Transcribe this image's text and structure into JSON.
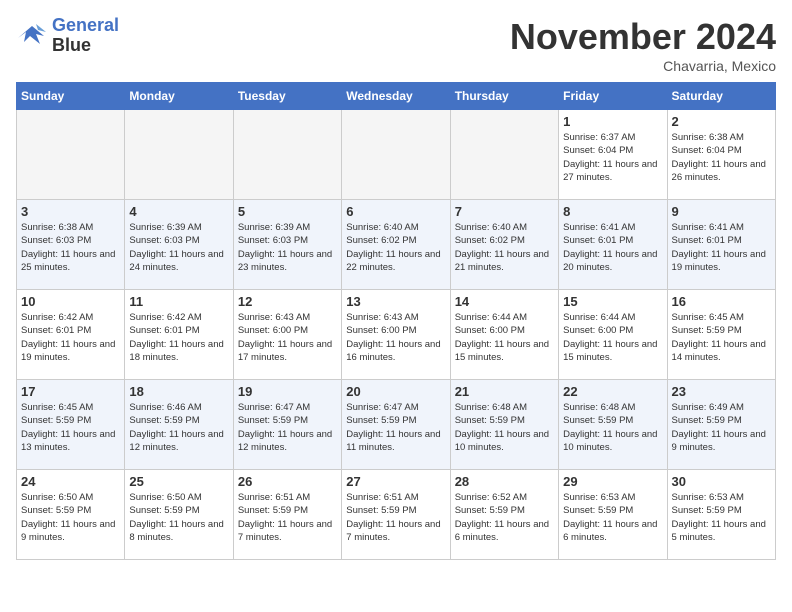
{
  "logo": {
    "line1": "General",
    "line2": "Blue"
  },
  "title": "November 2024",
  "location": "Chavarria, Mexico",
  "days_of_week": [
    "Sunday",
    "Monday",
    "Tuesday",
    "Wednesday",
    "Thursday",
    "Friday",
    "Saturday"
  ],
  "weeks": [
    [
      {
        "day": "",
        "info": "",
        "empty": true
      },
      {
        "day": "",
        "info": "",
        "empty": true
      },
      {
        "day": "",
        "info": "",
        "empty": true
      },
      {
        "day": "",
        "info": "",
        "empty": true
      },
      {
        "day": "",
        "info": "",
        "empty": true
      },
      {
        "day": "1",
        "info": "Sunrise: 6:37 AM\nSunset: 6:04 PM\nDaylight: 11 hours and 27 minutes.",
        "empty": false
      },
      {
        "day": "2",
        "info": "Sunrise: 6:38 AM\nSunset: 6:04 PM\nDaylight: 11 hours and 26 minutes.",
        "empty": false
      }
    ],
    [
      {
        "day": "3",
        "info": "Sunrise: 6:38 AM\nSunset: 6:03 PM\nDaylight: 11 hours and 25 minutes.",
        "empty": false
      },
      {
        "day": "4",
        "info": "Sunrise: 6:39 AM\nSunset: 6:03 PM\nDaylight: 11 hours and 24 minutes.",
        "empty": false
      },
      {
        "day": "5",
        "info": "Sunrise: 6:39 AM\nSunset: 6:03 PM\nDaylight: 11 hours and 23 minutes.",
        "empty": false
      },
      {
        "day": "6",
        "info": "Sunrise: 6:40 AM\nSunset: 6:02 PM\nDaylight: 11 hours and 22 minutes.",
        "empty": false
      },
      {
        "day": "7",
        "info": "Sunrise: 6:40 AM\nSunset: 6:02 PM\nDaylight: 11 hours and 21 minutes.",
        "empty": false
      },
      {
        "day": "8",
        "info": "Sunrise: 6:41 AM\nSunset: 6:01 PM\nDaylight: 11 hours and 20 minutes.",
        "empty": false
      },
      {
        "day": "9",
        "info": "Sunrise: 6:41 AM\nSunset: 6:01 PM\nDaylight: 11 hours and 19 minutes.",
        "empty": false
      }
    ],
    [
      {
        "day": "10",
        "info": "Sunrise: 6:42 AM\nSunset: 6:01 PM\nDaylight: 11 hours and 19 minutes.",
        "empty": false
      },
      {
        "day": "11",
        "info": "Sunrise: 6:42 AM\nSunset: 6:01 PM\nDaylight: 11 hours and 18 minutes.",
        "empty": false
      },
      {
        "day": "12",
        "info": "Sunrise: 6:43 AM\nSunset: 6:00 PM\nDaylight: 11 hours and 17 minutes.",
        "empty": false
      },
      {
        "day": "13",
        "info": "Sunrise: 6:43 AM\nSunset: 6:00 PM\nDaylight: 11 hours and 16 minutes.",
        "empty": false
      },
      {
        "day": "14",
        "info": "Sunrise: 6:44 AM\nSunset: 6:00 PM\nDaylight: 11 hours and 15 minutes.",
        "empty": false
      },
      {
        "day": "15",
        "info": "Sunrise: 6:44 AM\nSunset: 6:00 PM\nDaylight: 11 hours and 15 minutes.",
        "empty": false
      },
      {
        "day": "16",
        "info": "Sunrise: 6:45 AM\nSunset: 5:59 PM\nDaylight: 11 hours and 14 minutes.",
        "empty": false
      }
    ],
    [
      {
        "day": "17",
        "info": "Sunrise: 6:45 AM\nSunset: 5:59 PM\nDaylight: 11 hours and 13 minutes.",
        "empty": false
      },
      {
        "day": "18",
        "info": "Sunrise: 6:46 AM\nSunset: 5:59 PM\nDaylight: 11 hours and 12 minutes.",
        "empty": false
      },
      {
        "day": "19",
        "info": "Sunrise: 6:47 AM\nSunset: 5:59 PM\nDaylight: 11 hours and 12 minutes.",
        "empty": false
      },
      {
        "day": "20",
        "info": "Sunrise: 6:47 AM\nSunset: 5:59 PM\nDaylight: 11 hours and 11 minutes.",
        "empty": false
      },
      {
        "day": "21",
        "info": "Sunrise: 6:48 AM\nSunset: 5:59 PM\nDaylight: 11 hours and 10 minutes.",
        "empty": false
      },
      {
        "day": "22",
        "info": "Sunrise: 6:48 AM\nSunset: 5:59 PM\nDaylight: 11 hours and 10 minutes.",
        "empty": false
      },
      {
        "day": "23",
        "info": "Sunrise: 6:49 AM\nSunset: 5:59 PM\nDaylight: 11 hours and 9 minutes.",
        "empty": false
      }
    ],
    [
      {
        "day": "24",
        "info": "Sunrise: 6:50 AM\nSunset: 5:59 PM\nDaylight: 11 hours and 9 minutes.",
        "empty": false
      },
      {
        "day": "25",
        "info": "Sunrise: 6:50 AM\nSunset: 5:59 PM\nDaylight: 11 hours and 8 minutes.",
        "empty": false
      },
      {
        "day": "26",
        "info": "Sunrise: 6:51 AM\nSunset: 5:59 PM\nDaylight: 11 hours and 7 minutes.",
        "empty": false
      },
      {
        "day": "27",
        "info": "Sunrise: 6:51 AM\nSunset: 5:59 PM\nDaylight: 11 hours and 7 minutes.",
        "empty": false
      },
      {
        "day": "28",
        "info": "Sunrise: 6:52 AM\nSunset: 5:59 PM\nDaylight: 11 hours and 6 minutes.",
        "empty": false
      },
      {
        "day": "29",
        "info": "Sunrise: 6:53 AM\nSunset: 5:59 PM\nDaylight: 11 hours and 6 minutes.",
        "empty": false
      },
      {
        "day": "30",
        "info": "Sunrise: 6:53 AM\nSunset: 5:59 PM\nDaylight: 11 hours and 5 minutes.",
        "empty": false
      }
    ]
  ]
}
